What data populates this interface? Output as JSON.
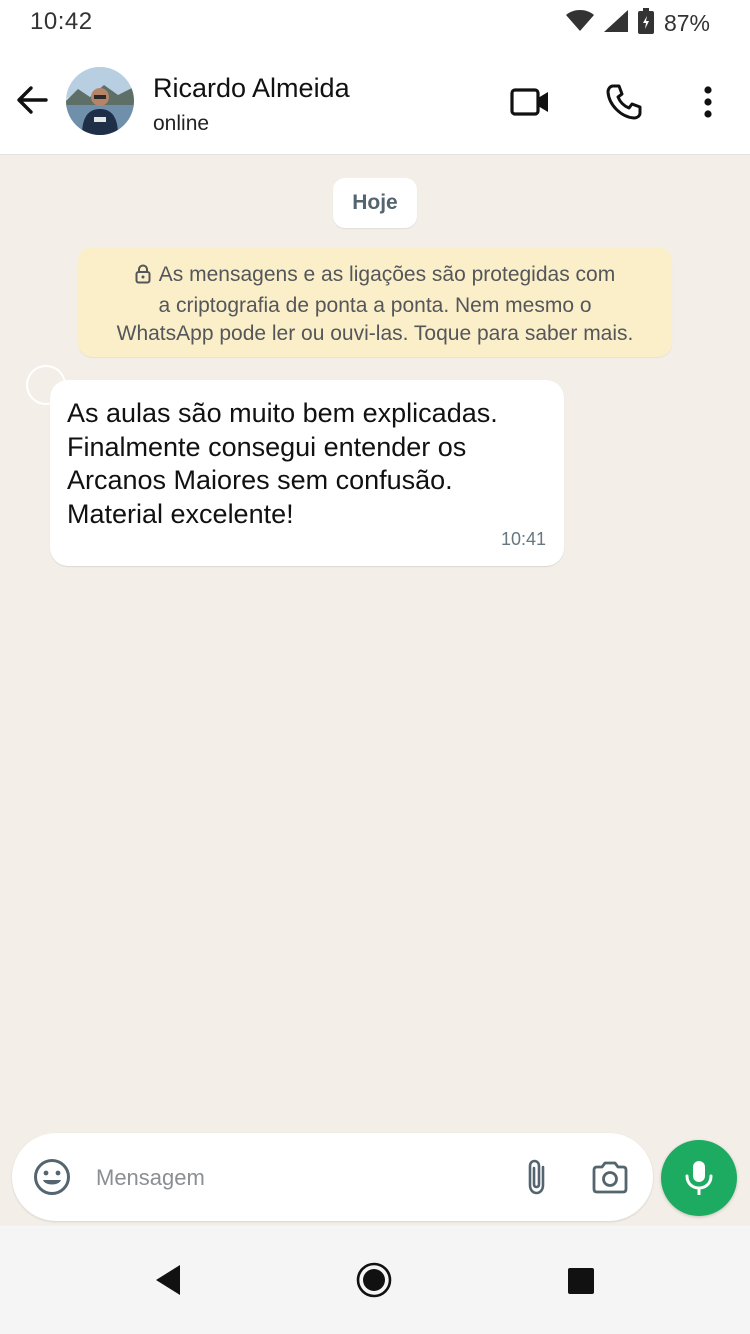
{
  "status_bar": {
    "time": "10:42",
    "battery": "87%",
    "icons": [
      "wifi-icon",
      "signal-icon",
      "battery-icon"
    ]
  },
  "header": {
    "contact_name": "Ricardo Almeida",
    "contact_status": "online",
    "icons": [
      "back-arrow-icon",
      "video-call-icon",
      "phone-icon",
      "more-vert-icon"
    ]
  },
  "chat": {
    "date_chip": "Hoje",
    "encryption_notice": {
      "line1": "As mensagens e as ligações são protegidas com",
      "line2": "a criptografia de ponta a ponta. Nem mesmo o",
      "line3": "WhatsApp pode ler ou ouvi-las. Toque para saber mais."
    },
    "messages": [
      {
        "lines": [
          "As aulas são muito bem explicadas.",
          "Finalmente consegui entender os",
          "Arcanos Maiores sem confusão.",
          "Material excelente!"
        ],
        "time": "10:41"
      }
    ]
  },
  "composer": {
    "placeholder": "Mensagem",
    "value": "",
    "icons": [
      "emoji-icon",
      "paperclip-icon",
      "camera-icon",
      "mic-icon"
    ]
  },
  "colors": {
    "accent_green": "#1daa61",
    "chat_background": "#f3efe8",
    "notice_background": "#fbefc9"
  }
}
